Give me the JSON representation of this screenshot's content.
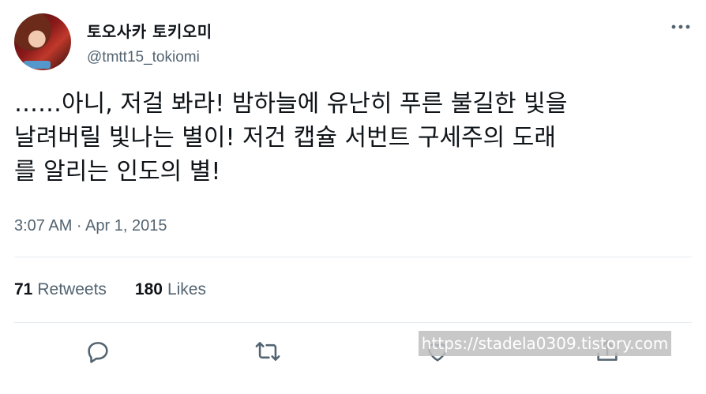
{
  "author": {
    "display_name": "토오사카 토키오미",
    "handle": "@tmtt15_tokiomi"
  },
  "tweet": {
    "text": "……아니, 저걸 봐라! 밤하늘에 유난히 푸른 불길한 빛을\n날려버릴 빛나는 별이! 저건 캡슐 서번트 구세주의 도래\n를 알리는 인도의 별!",
    "timestamp": "3:07 AM · Apr 1, 2015"
  },
  "stats": {
    "retweets_count": "71",
    "retweets_label": "Retweets",
    "likes_count": "180",
    "likes_label": "Likes"
  },
  "icons": {
    "more": "more-icon",
    "reply": "reply-icon",
    "retweet": "retweet-icon",
    "like": "like-icon",
    "share": "share-icon"
  },
  "colors": {
    "text": "#0f1419",
    "secondary": "#536471",
    "divider": "#e6ecf0"
  },
  "watermark": {
    "text": "https://stadela0309.tistory.com"
  }
}
